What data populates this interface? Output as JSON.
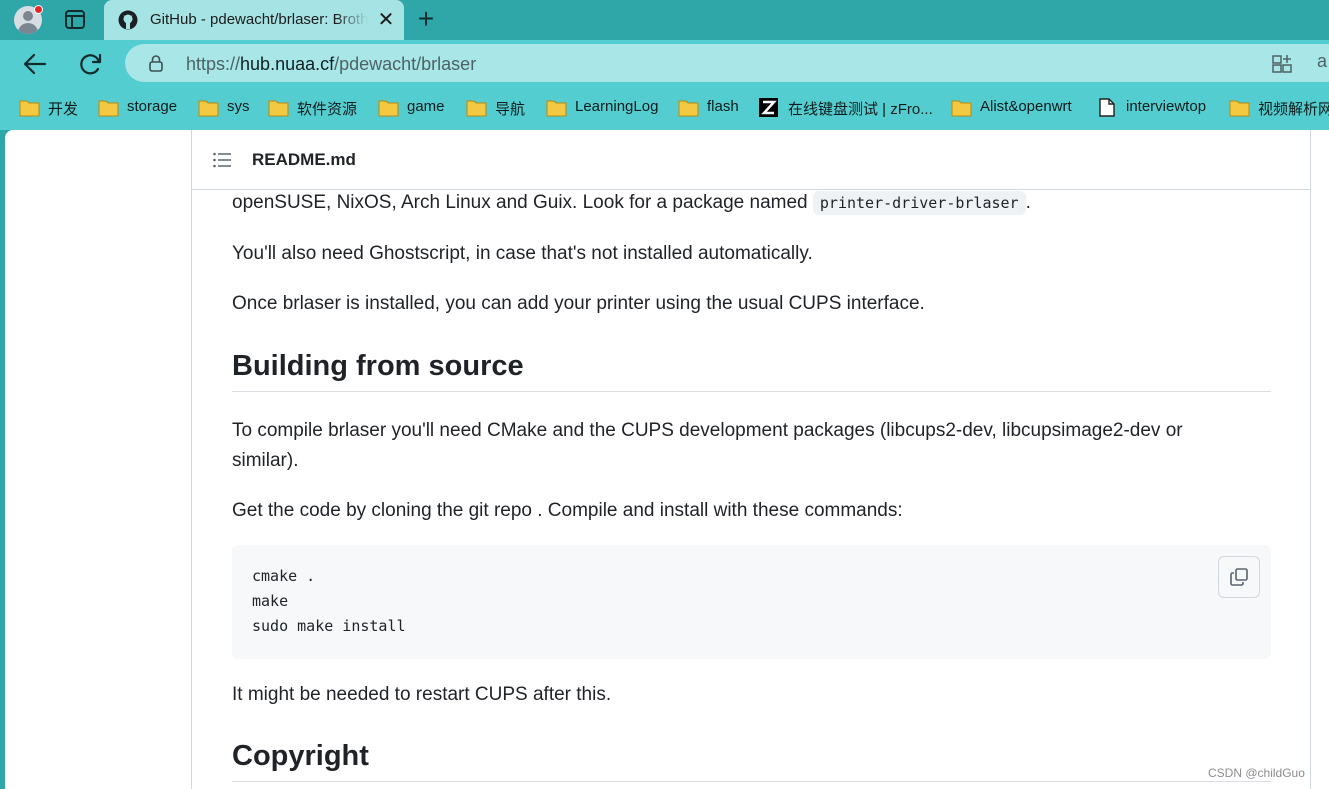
{
  "browser": {
    "tab": {
      "title": "GitHub - pdewacht/brlaser: Brother",
      "close_glyph": "✕"
    },
    "new_tab_glyph": "+",
    "url": {
      "prefix": "https://",
      "host": "hub.nuaa.cf",
      "path": "/pdewacht/brlaser"
    },
    "read_aloud_glyph": "a"
  },
  "bookmarks": [
    {
      "label": "开发",
      "icon": "folder-icon"
    },
    {
      "label": "storage",
      "icon": "folder-icon"
    },
    {
      "label": "sys",
      "icon": "folder-icon"
    },
    {
      "label": "软件资源",
      "icon": "folder-icon"
    },
    {
      "label": "game",
      "icon": "folder-icon"
    },
    {
      "label": "导航",
      "icon": "folder-icon"
    },
    {
      "label": "LearningLog",
      "icon": "folder-icon"
    },
    {
      "label": "flash",
      "icon": "folder-icon"
    },
    {
      "label": "在线键盘测试 | zFro...",
      "icon": "z-logo-icon"
    },
    {
      "label": "Alist&openwrt",
      "icon": "folder-icon"
    },
    {
      "label": "interviewtop",
      "icon": "page-icon"
    },
    {
      "label": "视频解析网",
      "icon": "folder-icon"
    }
  ],
  "readme": {
    "file_name": "README.md",
    "p1_text": "openSUSE, NixOS, Arch Linux and Guix. Look for a package named ",
    "p1_code": "printer-driver-brlaser",
    "p1_end": ".",
    "p2": "You'll also need Ghostscript, in case that's not installed automatically.",
    "p3": "Once brlaser is installed, you can add your printer using the usual CUPS interface.",
    "h_building": "Building from source",
    "p4_line1": "To compile brlaser you'll need CMake and the CUPS development packages (libcups2-dev, libcupsimage2-dev or",
    "p4_line2": "similar).",
    "p5": "Get the code by cloning the git repo . Compile and install with these commands:",
    "code_lines": [
      "cmake .",
      "make",
      "sudo make install"
    ],
    "p6": "It might be needed to restart CUPS after this.",
    "h_copyright": "Copyright"
  },
  "watermark": "CSDN @childGuo",
  "colors": {
    "tabstrip": "#2fa7a8",
    "toolbar": "#53cdd0",
    "active_tab": "#a6e3e4",
    "folder": "#f5c842"
  }
}
